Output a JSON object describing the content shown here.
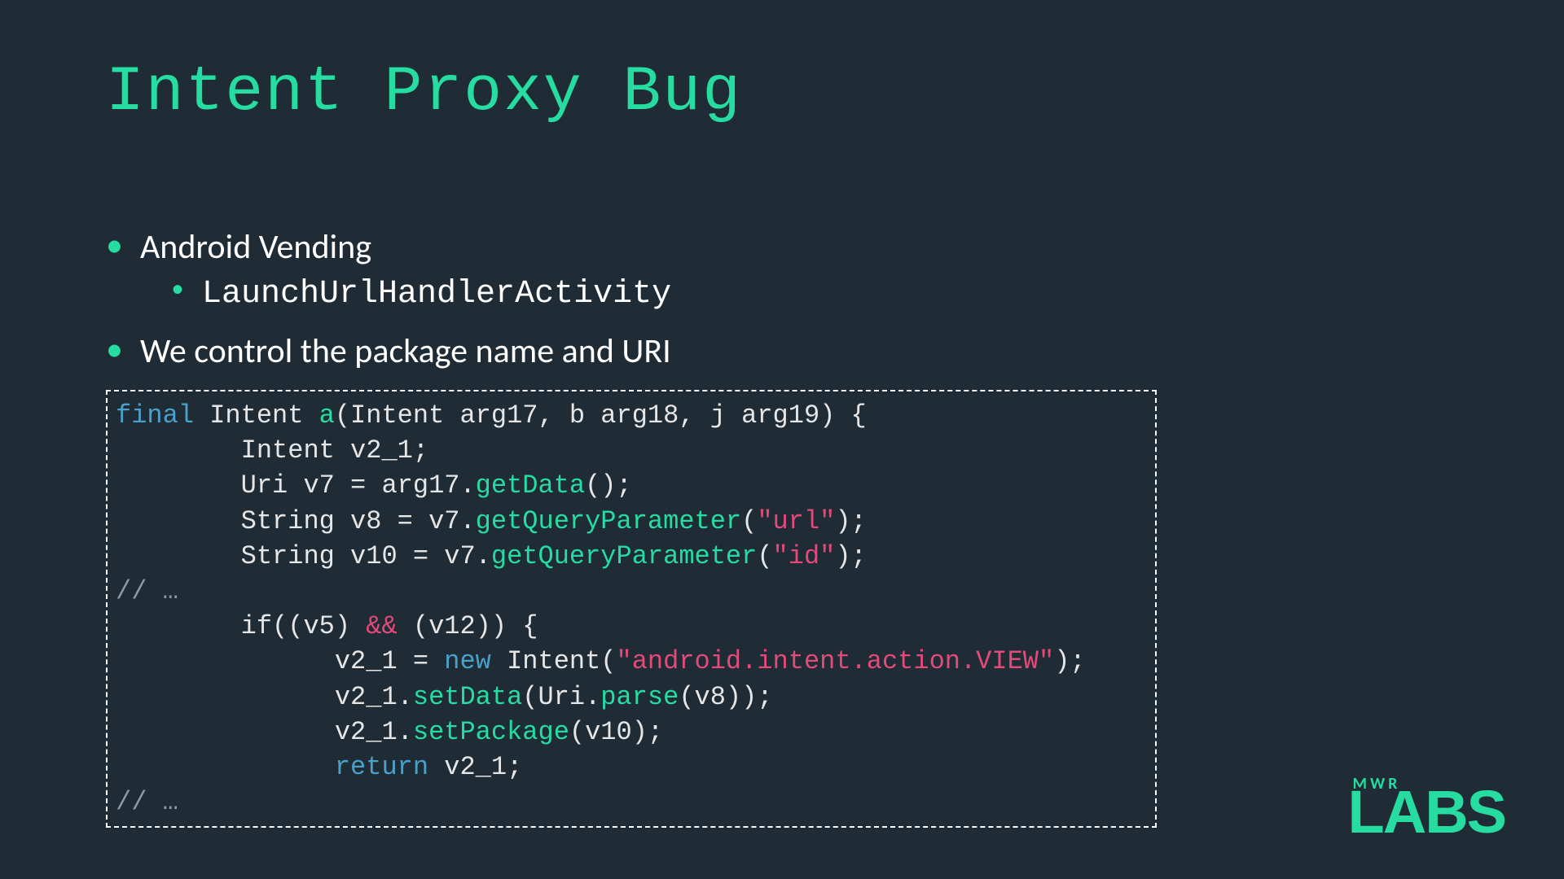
{
  "title": "Intent Proxy Bug",
  "bullets": {
    "b1": "Android Vending",
    "b1_sub1": "LaunchUrlHandlerActivity",
    "b2": "We control the package name and URI"
  },
  "code": {
    "l1_kw": "final",
    "l1_rest": " Intent ",
    "l1_fn": "a",
    "l1_tail": "(Intent arg17, b arg18, j arg19) {",
    "l2": "        Intent v2_1;",
    "l3_a": "        Uri v7 = arg17.",
    "l3_fn": "getData",
    "l3_b": "();",
    "l4_a": "        String v8 = v7.",
    "l4_fn": "getQueryParameter",
    "l4_b": "(",
    "l4_str": "\"url\"",
    "l4_c": ");",
    "l5_a": "        String v10 = v7.",
    "l5_fn": "getQueryParameter",
    "l5_b": "(",
    "l5_str": "\"id\"",
    "l5_c": ");",
    "l6_cm": "// …",
    "l7_a": "        if((v5) ",
    "l7_op": "&&",
    "l7_b": " (v12)) {",
    "l8_a": "              v2_1 = ",
    "l8_kw": "new",
    "l8_b": " Intent(",
    "l8_str": "\"android.intent.action.VIEW\"",
    "l8_c": ");",
    "l9_a": "              v2_1.",
    "l9_fn": "setData",
    "l9_b": "(Uri.",
    "l9_fn2": "parse",
    "l9_c": "(v8));",
    "l10_a": "              v2_1.",
    "l10_fn": "setPackage",
    "l10_b": "(v10);",
    "l11_a": "              ",
    "l11_kw": "return",
    "l11_b": " v2_1;",
    "l12_cm": "// …"
  },
  "logo": {
    "top": "MWR",
    "bottom": "LABS"
  }
}
